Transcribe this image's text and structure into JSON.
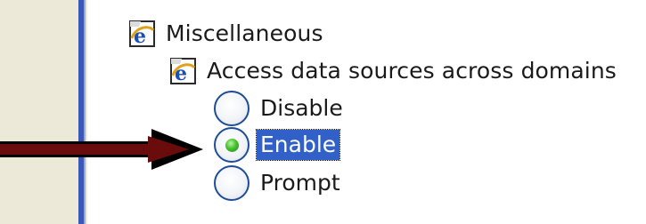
{
  "tree": {
    "category": {
      "label": "Miscellaneous",
      "icon": "ie-icon"
    },
    "setting": {
      "label": "Access data sources across domains",
      "icon": "ie-icon"
    },
    "options": [
      {
        "label": "Disable",
        "selected": false
      },
      {
        "label": "Enable",
        "selected": true
      },
      {
        "label": "Prompt",
        "selected": false
      }
    ]
  },
  "annotation": {
    "icon": "arrow-right-icon",
    "color": "#6b0c0c"
  },
  "colors": {
    "panel_border": "#3a58b8",
    "selection_highlight": "#3161c8",
    "radio_selected_dot": "#45c22f"
  }
}
